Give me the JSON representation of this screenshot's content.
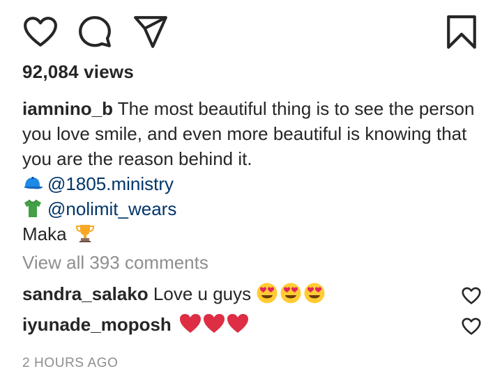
{
  "post": {
    "views": "92,084 views",
    "caption": {
      "username": "iamnino_b",
      "text": "The most beautiful thing is to see the person you love smile, and even more beautiful is knowing that you are the reason behind it.",
      "mention_1": "@1805.ministry",
      "mention_2": "@nolimit_wears",
      "last_line": "Maka"
    },
    "view_all_comments": "View all 393 comments",
    "comments": [
      {
        "username": "sandra_salako",
        "text": "Love u guys"
      },
      {
        "username": "iyunade_moposh",
        "text": ""
      }
    ],
    "timestamp": "2 HOURS AGO"
  },
  "icons": {
    "like": "heart-icon",
    "comment": "comment-icon",
    "share": "share-icon",
    "save": "bookmark-icon",
    "cap": "cap-icon",
    "tshirt": "tshirt-icon",
    "trophy": "trophy-icon",
    "heart_eyes": "heart-eyes-emoji",
    "red_heart": "red-heart-emoji"
  },
  "colors": {
    "text": "#262626",
    "muted": "#8e8e8e",
    "mention": "#003569",
    "heart_red": "#e0245e"
  }
}
